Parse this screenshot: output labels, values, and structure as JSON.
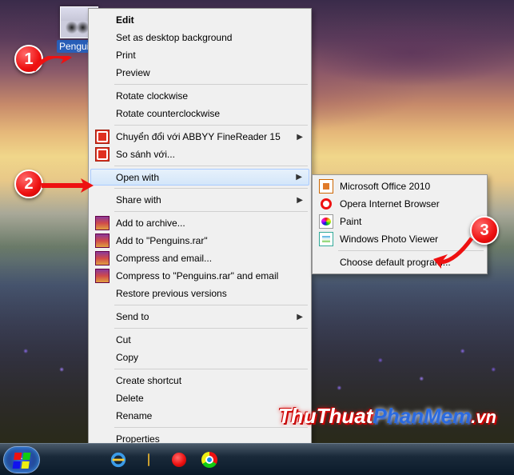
{
  "desktop": {
    "file": {
      "label": "Penguins"
    }
  },
  "context_menu": {
    "edit": "Edit",
    "set_background": "Set as desktop background",
    "print": "Print",
    "preview": "Preview",
    "rotate_cw": "Rotate clockwise",
    "rotate_ccw": "Rotate counterclockwise",
    "abbyy": "Chuyển đổi với ABBYY FineReader 15",
    "compare": "So sánh với...",
    "open_with": "Open with",
    "share_with": "Share with",
    "add_archive": "Add to archive...",
    "add_rar": "Add to \"Penguins.rar\"",
    "compress_email": "Compress and email...",
    "compress_rar_email": "Compress to \"Penguins.rar\" and email",
    "restore": "Restore previous versions",
    "send_to": "Send to",
    "cut": "Cut",
    "copy": "Copy",
    "create_shortcut": "Create shortcut",
    "delete": "Delete",
    "rename": "Rename",
    "properties": "Properties"
  },
  "submenu": {
    "mso": "Microsoft Office 2010",
    "opera": "Opera Internet Browser",
    "paint": "Paint",
    "wpv": "Windows Photo Viewer",
    "choose": "Choose default program..."
  },
  "callouts": {
    "one": "1",
    "two": "2",
    "three": "3"
  },
  "watermark": {
    "a": "ThuThuat",
    "b": "PhanMem",
    "c": ".vn"
  }
}
